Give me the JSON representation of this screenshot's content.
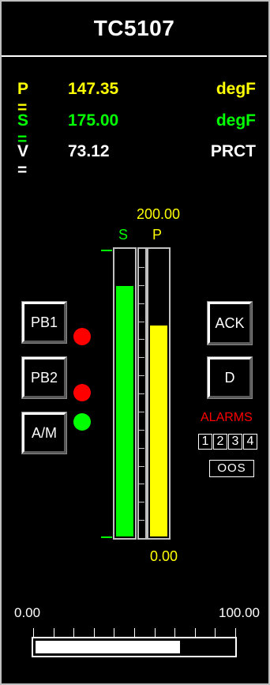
{
  "tag": "TC5107",
  "p_row": {
    "label": "P =",
    "value": "147.35",
    "unit": "degF",
    "color": "#ffff00"
  },
  "s_row": {
    "label": "S =",
    "value": "175.00",
    "unit": "degF",
    "color": "#00ff00"
  },
  "v_row": {
    "label": "V =",
    "value": "73.12",
    "unit": "PRCT",
    "color": "#ffffff"
  },
  "bargraph": {
    "scale_max": "200.00",
    "scale_min": "0.00",
    "s_label": "S",
    "p_label": "P",
    "s_value": 175.0,
    "p_value": 147.35,
    "range": [
      0,
      200
    ],
    "s_color": "#00ff00",
    "p_color": "#ffff00"
  },
  "buttons": {
    "pb1": "PB1",
    "pb2": "PB2",
    "am": "A/M",
    "ack": "ACK",
    "d": "D"
  },
  "lamps": {
    "pb1": "#ff0000",
    "pb2": "#ff0000",
    "am": "#00ff00"
  },
  "alarms": {
    "title": "ALARMS",
    "title_color": "#ff0000",
    "boxes": [
      "1",
      "2",
      "3",
      "4"
    ],
    "oos": "OOS"
  },
  "output": {
    "min_label": "0.00",
    "max_label": "100.00",
    "value": 73.12,
    "range": [
      0,
      100
    ]
  }
}
